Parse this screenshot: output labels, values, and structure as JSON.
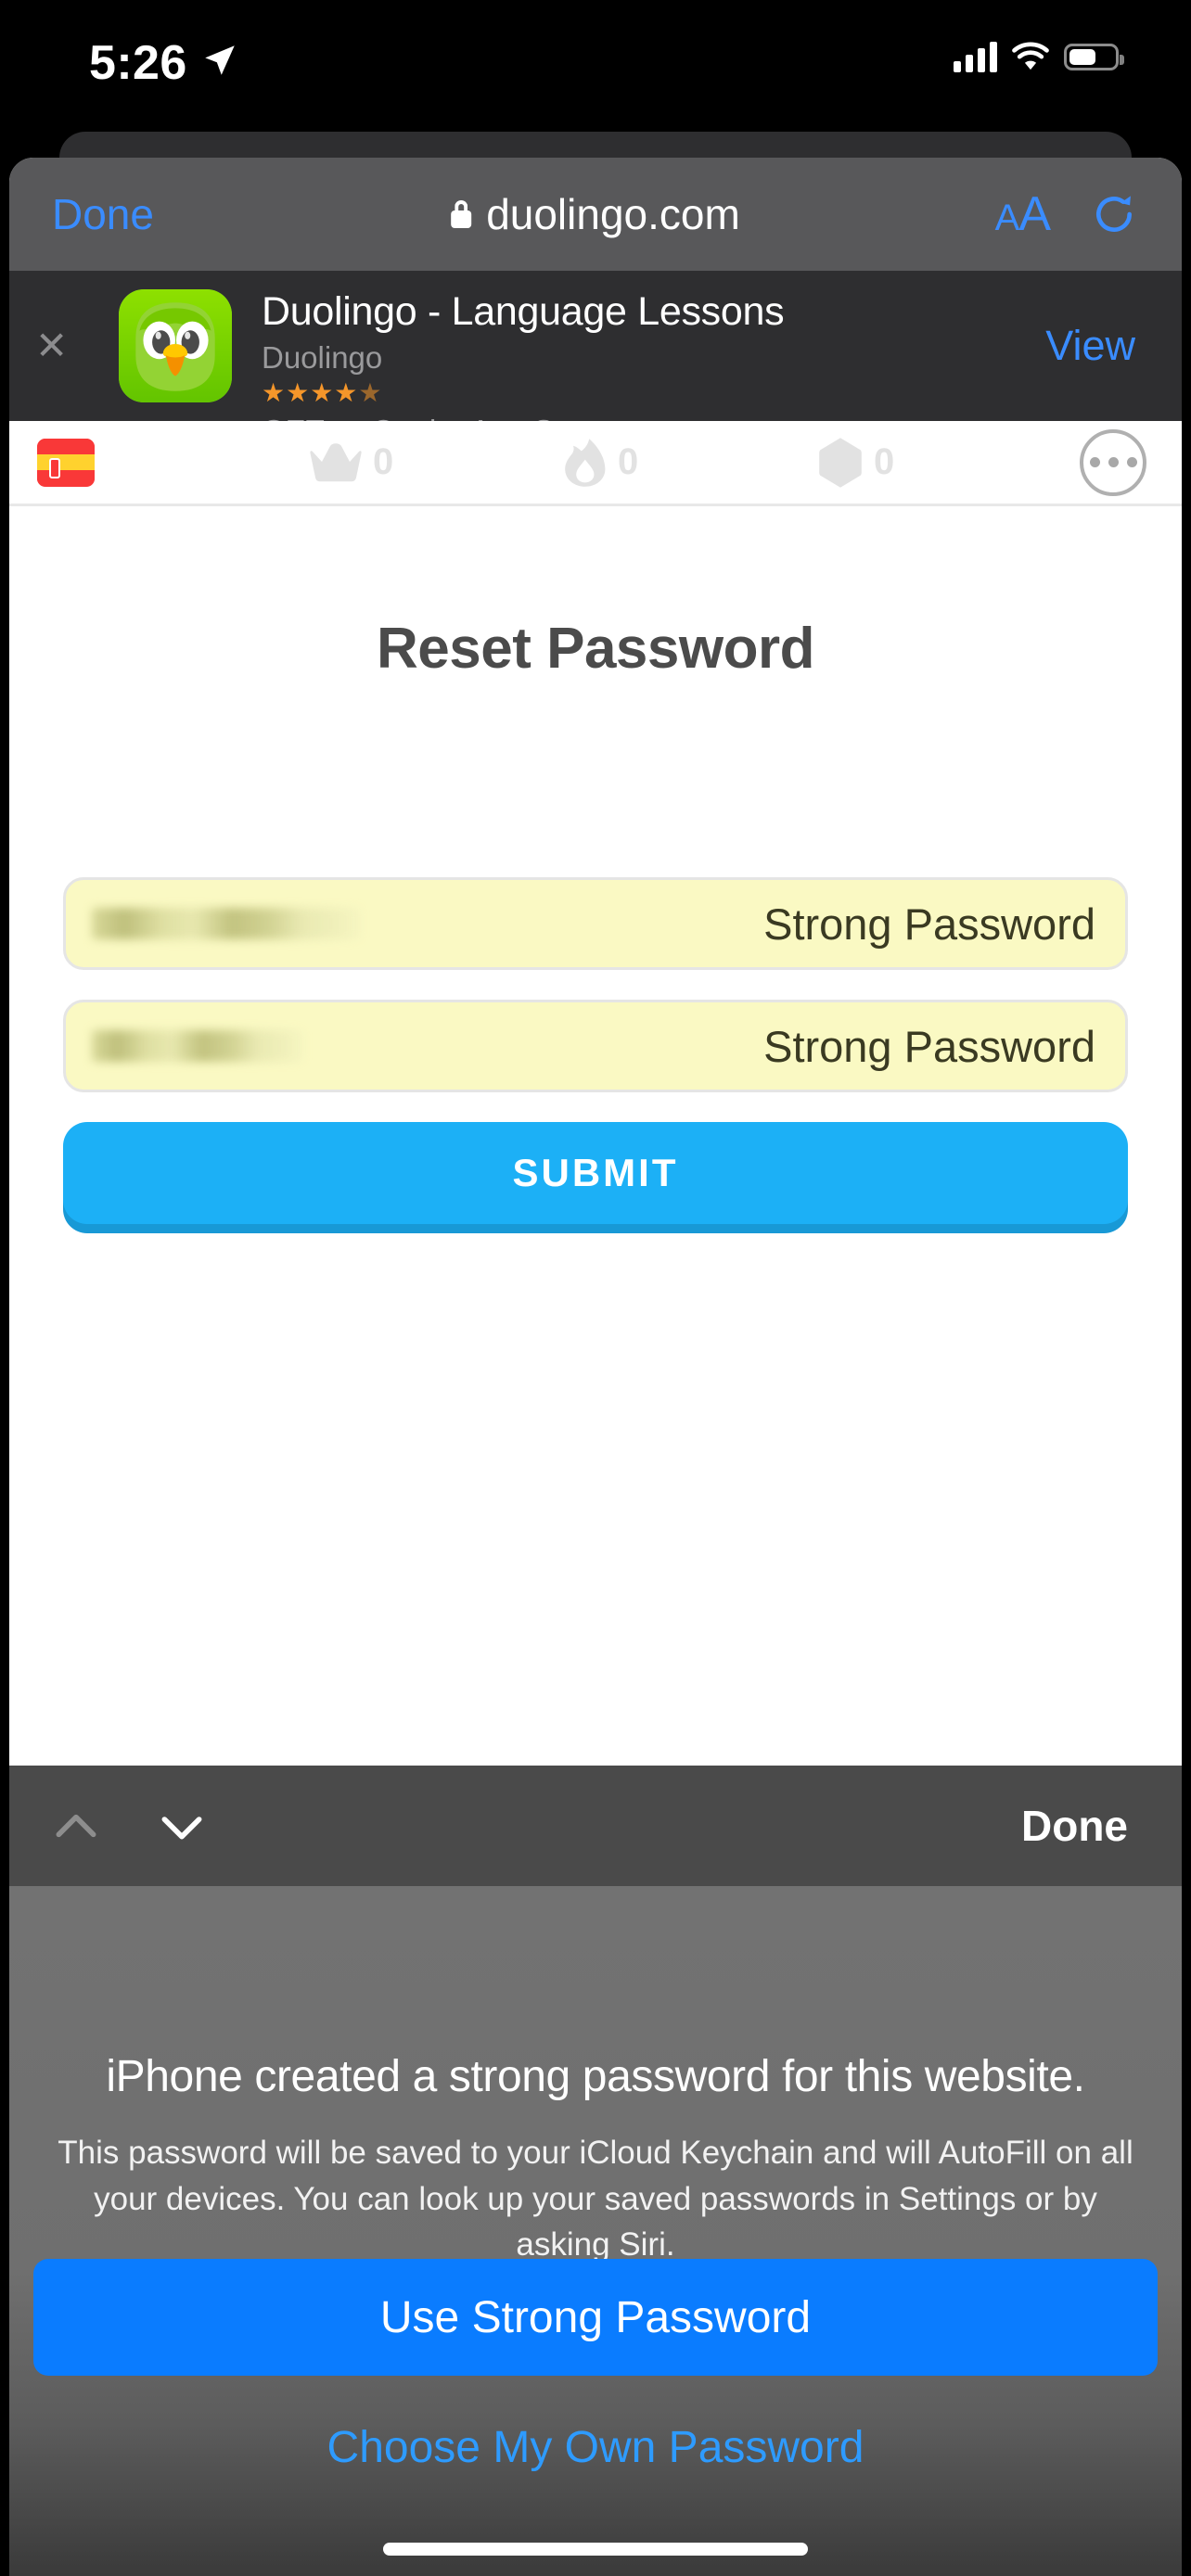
{
  "status_bar": {
    "time": "5:26",
    "location_icon": "location-arrow-icon",
    "cellular_icon": "signal-bars-icon",
    "wifi_icon": "wifi-icon",
    "battery_icon": "battery-icon"
  },
  "safari": {
    "done_label": "Done",
    "url": "duolingo.com",
    "lock_icon": "lock-icon",
    "text_size_label_small": "A",
    "text_size_label_large": "A",
    "reload_icon": "reload-icon"
  },
  "app_banner": {
    "close_icon": "close-x-icon",
    "app_icon": "duolingo-owl-icon",
    "title": "Duolingo - Language Lessons",
    "subtitle": "Duolingo",
    "stars": "★★★★",
    "half_star": "★",
    "rating_value": 4.5,
    "price_text": "GET — On the App Store",
    "view_label": "View"
  },
  "duolingo_nav": {
    "flag_icon": "spain-flag-icon",
    "crown_icon": "crown-icon",
    "crown_count": "0",
    "streak_icon": "flame-icon",
    "streak_count": "0",
    "gem_icon": "gem-icon",
    "gem_count": "0",
    "more_icon": "ellipsis-icon"
  },
  "reset_form": {
    "title": "Reset Password",
    "password_field": {
      "autofill_label": "Strong Password",
      "value_masked": true
    },
    "confirm_field": {
      "autofill_label": "Strong Password",
      "value_masked": true
    },
    "submit_label": "SUBMIT"
  },
  "keyboard_accessory": {
    "prev_icon": "chevron-up-icon",
    "next_icon": "chevron-down-icon",
    "done_label": "Done"
  },
  "password_sheet": {
    "title": "iPhone created a strong password for this website.",
    "body": "This password will be saved to your iCloud Keychain and will AutoFill on all your devices. You can look up your saved passwords in Settings or by asking Siri.",
    "primary_label": "Use Strong Password",
    "secondary_label": "Choose My Own Password"
  },
  "colors": {
    "ios_blue": "#0a7cff",
    "link_blue": "#3a8cff",
    "duo_blue": "#1cb0f6",
    "duo_blue_shadow": "#1899d6",
    "autofill_yellow": "#faf9c3",
    "star_orange": "#f5962a",
    "duo_text": "#4b4b4b"
  }
}
